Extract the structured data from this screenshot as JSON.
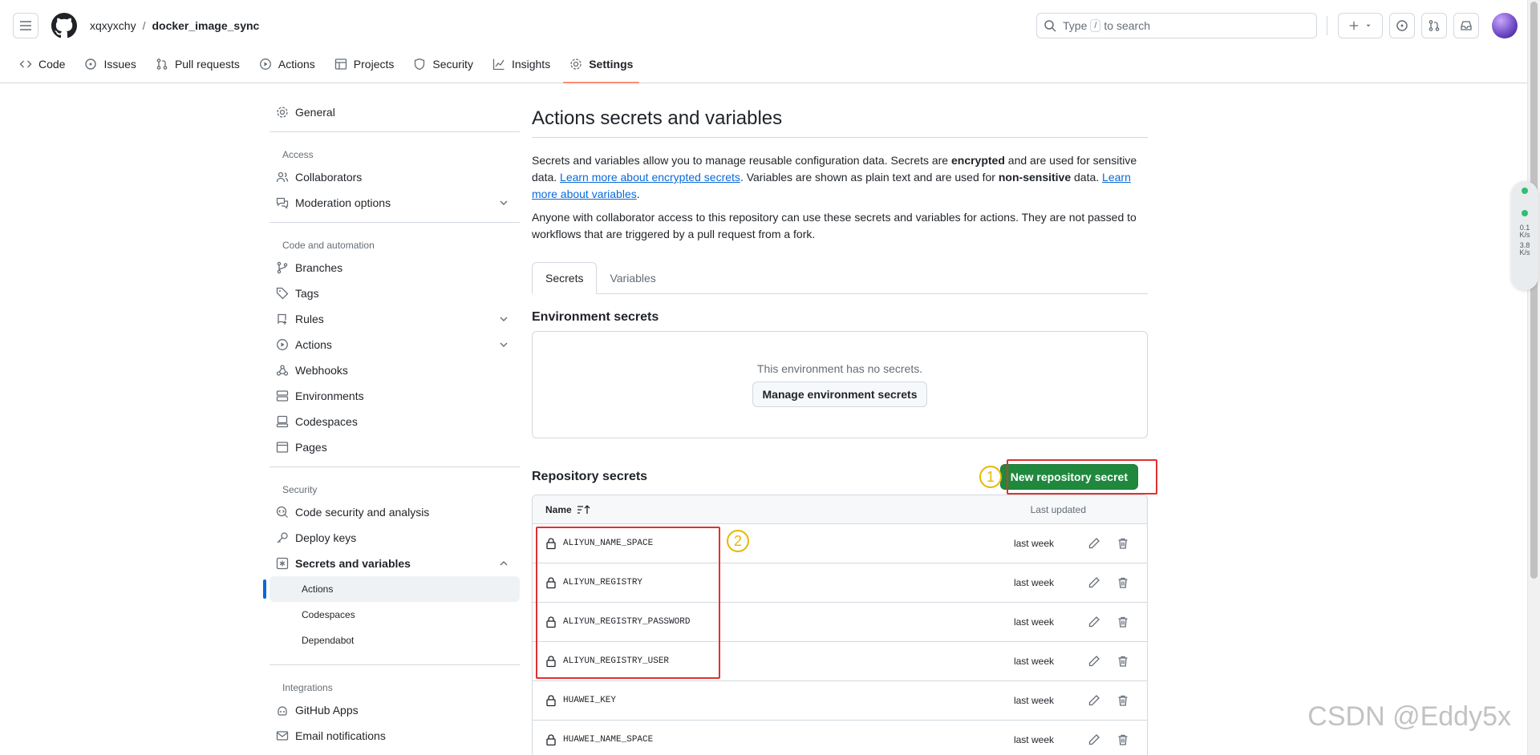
{
  "header": {
    "owner": "xqxyxchy",
    "separator": "/",
    "repo": "docker_image_sync",
    "search_prefix": "Type",
    "search_key": "/",
    "search_suffix": "to search"
  },
  "repo_nav": [
    {
      "label": "Code",
      "icon": "code-icon"
    },
    {
      "label": "Issues",
      "icon": "issue-icon"
    },
    {
      "label": "Pull requests",
      "icon": "pull-request-icon"
    },
    {
      "label": "Actions",
      "icon": "play-icon"
    },
    {
      "label": "Projects",
      "icon": "table-icon"
    },
    {
      "label": "Security",
      "icon": "shield-icon"
    },
    {
      "label": "Insights",
      "icon": "graph-icon"
    },
    {
      "label": "Settings",
      "icon": "gear-icon",
      "selected": true
    }
  ],
  "sidebar": {
    "general": "General",
    "access_heading": "Access",
    "collaborators": "Collaborators",
    "moderation": "Moderation options",
    "code_heading": "Code and automation",
    "branches": "Branches",
    "tags": "Tags",
    "rules": "Rules",
    "actions": "Actions",
    "webhooks": "Webhooks",
    "environments": "Environments",
    "codespaces": "Codespaces",
    "pages": "Pages",
    "security_heading": "Security",
    "code_security": "Code security and analysis",
    "deploy_keys": "Deploy keys",
    "secrets_vars": "Secrets and variables",
    "sub_actions": "Actions",
    "sub_codespaces": "Codespaces",
    "sub_dependabot": "Dependabot",
    "integrations_heading": "Integrations",
    "github_apps": "GitHub Apps",
    "email_notifications": "Email notifications"
  },
  "main": {
    "title": "Actions secrets and variables",
    "p1_a": "Secrets and variables allow you to manage reusable configuration data. Secrets are ",
    "p1_b": "encrypted",
    "p1_c": " and are used for sensitive data. ",
    "p1_link1": "Learn more about encrypted secrets",
    "p1_d": ". Variables are shown as plain text and are used for ",
    "p1_e": "non-sensitive",
    "p1_f": " data. ",
    "p1_link2": "Learn more about variables",
    "p1_g": ".",
    "p2": "Anyone with collaborator access to this repository can use these secrets and variables for actions. They are not passed to workflows that are triggered by a pull request from a fork.",
    "tab_secrets": "Secrets",
    "tab_variables": "Variables",
    "env_title": "Environment secrets",
    "env_empty": "This environment has no secrets.",
    "env_button": "Manage environment secrets",
    "repo_title": "Repository secrets",
    "new_secret_button": "New repository secret",
    "annotation_1": "1",
    "annotation_2": "2",
    "col_name": "Name",
    "col_updated": "Last updated",
    "secrets": [
      {
        "name": "ALIYUN_NAME_SPACE",
        "updated": "last week"
      },
      {
        "name": "ALIYUN_REGISTRY",
        "updated": "last week"
      },
      {
        "name": "ALIYUN_REGISTRY_PASSWORD",
        "updated": "last week"
      },
      {
        "name": "ALIYUN_REGISTRY_USER",
        "updated": "last week"
      },
      {
        "name": "HUAWEI_KEY",
        "updated": "last week"
      },
      {
        "name": "HUAWEI_NAME_SPACE",
        "updated": "last week"
      }
    ]
  },
  "widget": {
    "up": "0.1",
    "up_unit": "K/s",
    "down": "3.8",
    "down_unit": "K/s"
  },
  "watermark": "CSDN @Eddy5x",
  "colors": {
    "accent": "#0969da",
    "primary": "#1f883d",
    "annotation_red": "#e03131",
    "annotation_yellow": "#e6b800",
    "tab_underline": "#fd8c73"
  }
}
